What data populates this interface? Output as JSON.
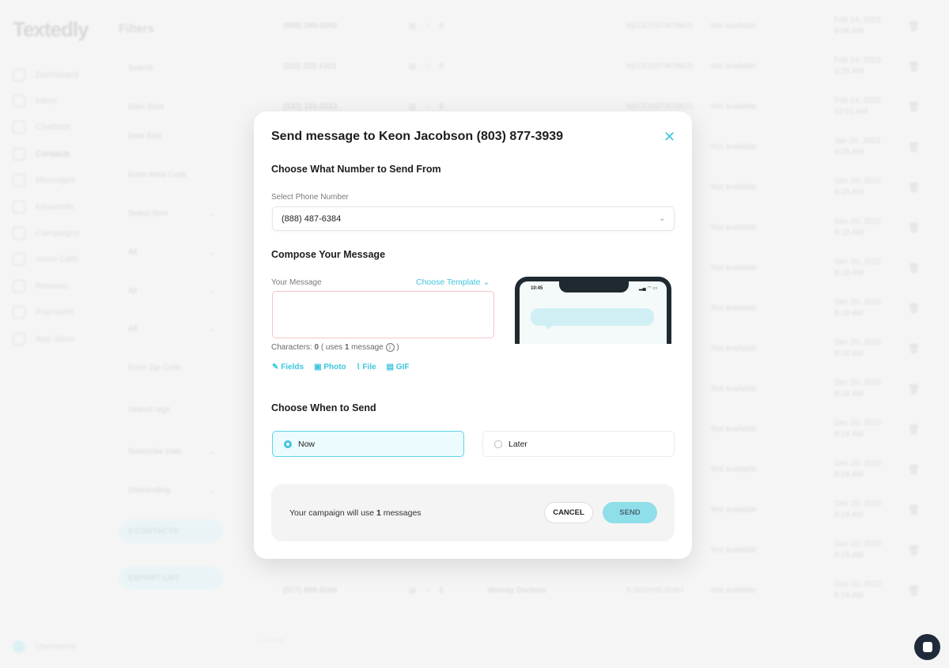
{
  "app": {
    "logo": "Textedly"
  },
  "sidebar": {
    "items": [
      {
        "label": "Dashboard",
        "icon": "home-icon"
      },
      {
        "label": "Inbox",
        "icon": "inbox-icon"
      },
      {
        "label": "Chatbots",
        "icon": "network-icon"
      },
      {
        "label": "Contacts",
        "icon": "user-icon",
        "active": true
      },
      {
        "label": "Messages",
        "icon": "message-icon"
      },
      {
        "label": "Keywords",
        "icon": "key-icon"
      },
      {
        "label": "Campaigns",
        "icon": "hash-icon"
      },
      {
        "label": "Voice Calls",
        "icon": "phone-icon"
      },
      {
        "label": "Reviews",
        "icon": "star-icon"
      },
      {
        "label": "Payments",
        "icon": "dollar-icon"
      },
      {
        "label": "App Store",
        "icon": "grid-icon"
      }
    ],
    "user": "Username"
  },
  "filters": {
    "title": "Filters",
    "search": "Search",
    "date_start": "Date Start",
    "date_end": "Date End",
    "area_code": "Enter Area Code",
    "select_item": "Select Item",
    "all_1": "All",
    "all_2": "All",
    "all_3": "All",
    "zip": "Enter Zip Code",
    "tags": "Search tags",
    "sort_by": "Subscribe Date",
    "order": "Descending",
    "contacts_btn": "0 CONTACTS",
    "export_btn": "EXPORT LIST"
  },
  "rows": [
    {
      "phone": "(999) 299-9292",
      "name": "",
      "keyword": "NECESSITATIBUS",
      "status": "Not available",
      "date": "Feb 14, 2023",
      "time": "8:08 AM"
    },
    {
      "phone": "(111) 222-1321",
      "name": "",
      "keyword": "NECESSITATIBUS",
      "status": "Not available",
      "date": "Feb 14, 2023",
      "time": "3:23 AM"
    },
    {
      "phone": "(132) 131-3213",
      "name": "",
      "keyword": "NECESSITATIBUS",
      "status": "Not available",
      "date": "Feb 14, 2023",
      "time": "12:01 AM"
    },
    {
      "phone": "",
      "name": "",
      "keyword": "",
      "status": "Not available",
      "date": "Jan 20, 2023",
      "time": "4:05 AM"
    },
    {
      "phone": "",
      "name": "",
      "keyword": "",
      "status": "Not available",
      "date": "Dec 20, 2022",
      "time": "8:15 AM"
    },
    {
      "phone": "",
      "name": "",
      "keyword": "",
      "status": "Not available",
      "date": "Dec 20, 2022",
      "time": "8:18 AM"
    },
    {
      "phone": "",
      "name": "",
      "keyword": "",
      "status": "Not available",
      "date": "Dec 20, 2022",
      "time": "8:18 AM"
    },
    {
      "phone": "",
      "name": "",
      "keyword": "",
      "status": "Not available",
      "date": "Dec 20, 2022",
      "time": "8:18 AM"
    },
    {
      "phone": "",
      "name": "",
      "keyword": "",
      "status": "Not available",
      "date": "Dec 20, 2022",
      "time": "8:18 AM"
    },
    {
      "phone": "",
      "name": "",
      "keyword": "",
      "status": "Not available",
      "date": "Dec 20, 2022",
      "time": "8:18 AM"
    },
    {
      "phone": "",
      "name": "",
      "keyword": "",
      "status": "Not available",
      "date": "Dec 20, 2022",
      "time": "8:18 AM"
    },
    {
      "phone": "",
      "name": "",
      "keyword": "",
      "status": "Not available",
      "date": "Dec 20, 2022",
      "time": "8:18 AM"
    },
    {
      "phone": "",
      "name": "",
      "keyword": "",
      "status": "Not available",
      "date": "Dec 20, 2022",
      "time": "8:18 AM"
    },
    {
      "phone": "",
      "name": "",
      "keyword": "",
      "status": "Not available",
      "date": "Dec 20, 2022",
      "time": "8:18 AM"
    },
    {
      "phone": "(577) 688-8166",
      "name": "Murray Deckow",
      "keyword": "KJAOSHKJSAH",
      "status": "Not available",
      "date": "Dec 20, 2022",
      "time": "8:18 AM"
    }
  ],
  "modal": {
    "title": "Send message to Keon Jacobson (803) 877-3939",
    "section_from": "Choose What Number to Send From",
    "select_label": "Select Phone Number",
    "select_value": "(888) 487-6384",
    "section_compose": "Compose Your Message",
    "message_label": "Your Message",
    "message_value": "",
    "choose_template": "Choose Template",
    "chars_label": "Characters:",
    "chars_count": "0",
    "uses_prefix": "( uses",
    "uses_count": "1",
    "uses_suffix": "message",
    "close_paren": ")",
    "tools": [
      "Fields",
      "Photo",
      "File",
      "GIF"
    ],
    "phone_time": "10:45",
    "section_when": "Choose When to Send",
    "option_now": "Now",
    "option_later": "Later",
    "selected": "Now",
    "footer_prefix": "Your campaign will use",
    "footer_count": "1",
    "footer_suffix": "messages",
    "cancel": "CANCEL",
    "send": "SEND"
  },
  "colors": {
    "accent": "#3fc6de",
    "send_bg": "#8fdfea",
    "error_border": "#f7c4c8"
  }
}
